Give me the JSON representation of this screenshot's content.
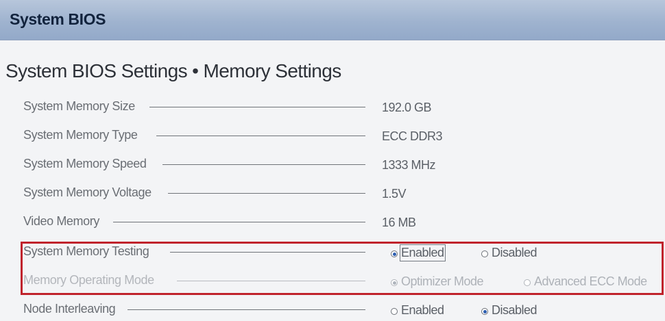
{
  "header": {
    "title": "System BIOS"
  },
  "page": {
    "title": "System BIOS Settings • Memory Settings"
  },
  "settings": [
    {
      "label": "System Memory Size",
      "value": "192.0 GB"
    },
    {
      "label": "System Memory Type",
      "value": "ECC DDR3"
    },
    {
      "label": "System Memory Speed",
      "value": "1333 MHz"
    },
    {
      "label": "System Memory Voltage",
      "value": "1.5V"
    },
    {
      "label": "Video Memory",
      "value": "16 MB"
    },
    {
      "label": "System Memory Testing",
      "options": [
        {
          "label": "Enabled",
          "selected": true
        },
        {
          "label": "Disabled",
          "selected": false
        }
      ]
    },
    {
      "label": "Memory Operating Mode",
      "disabled": true,
      "options": [
        {
          "label": "Optimizer Mode",
          "selected": true
        },
        {
          "label": "Advanced ECC Mode",
          "selected": false
        }
      ]
    },
    {
      "label": "Node Interleaving",
      "options": [
        {
          "label": "Enabled",
          "selected": false
        },
        {
          "label": "Disabled",
          "selected": true
        }
      ]
    }
  ],
  "colors": {
    "titlebar_start": "#b7c6db",
    "titlebar_end": "#93a9c9",
    "highlight_border": "#c0232c",
    "radio_selected": "#2d5fb1",
    "background": "#f3f4f6"
  }
}
